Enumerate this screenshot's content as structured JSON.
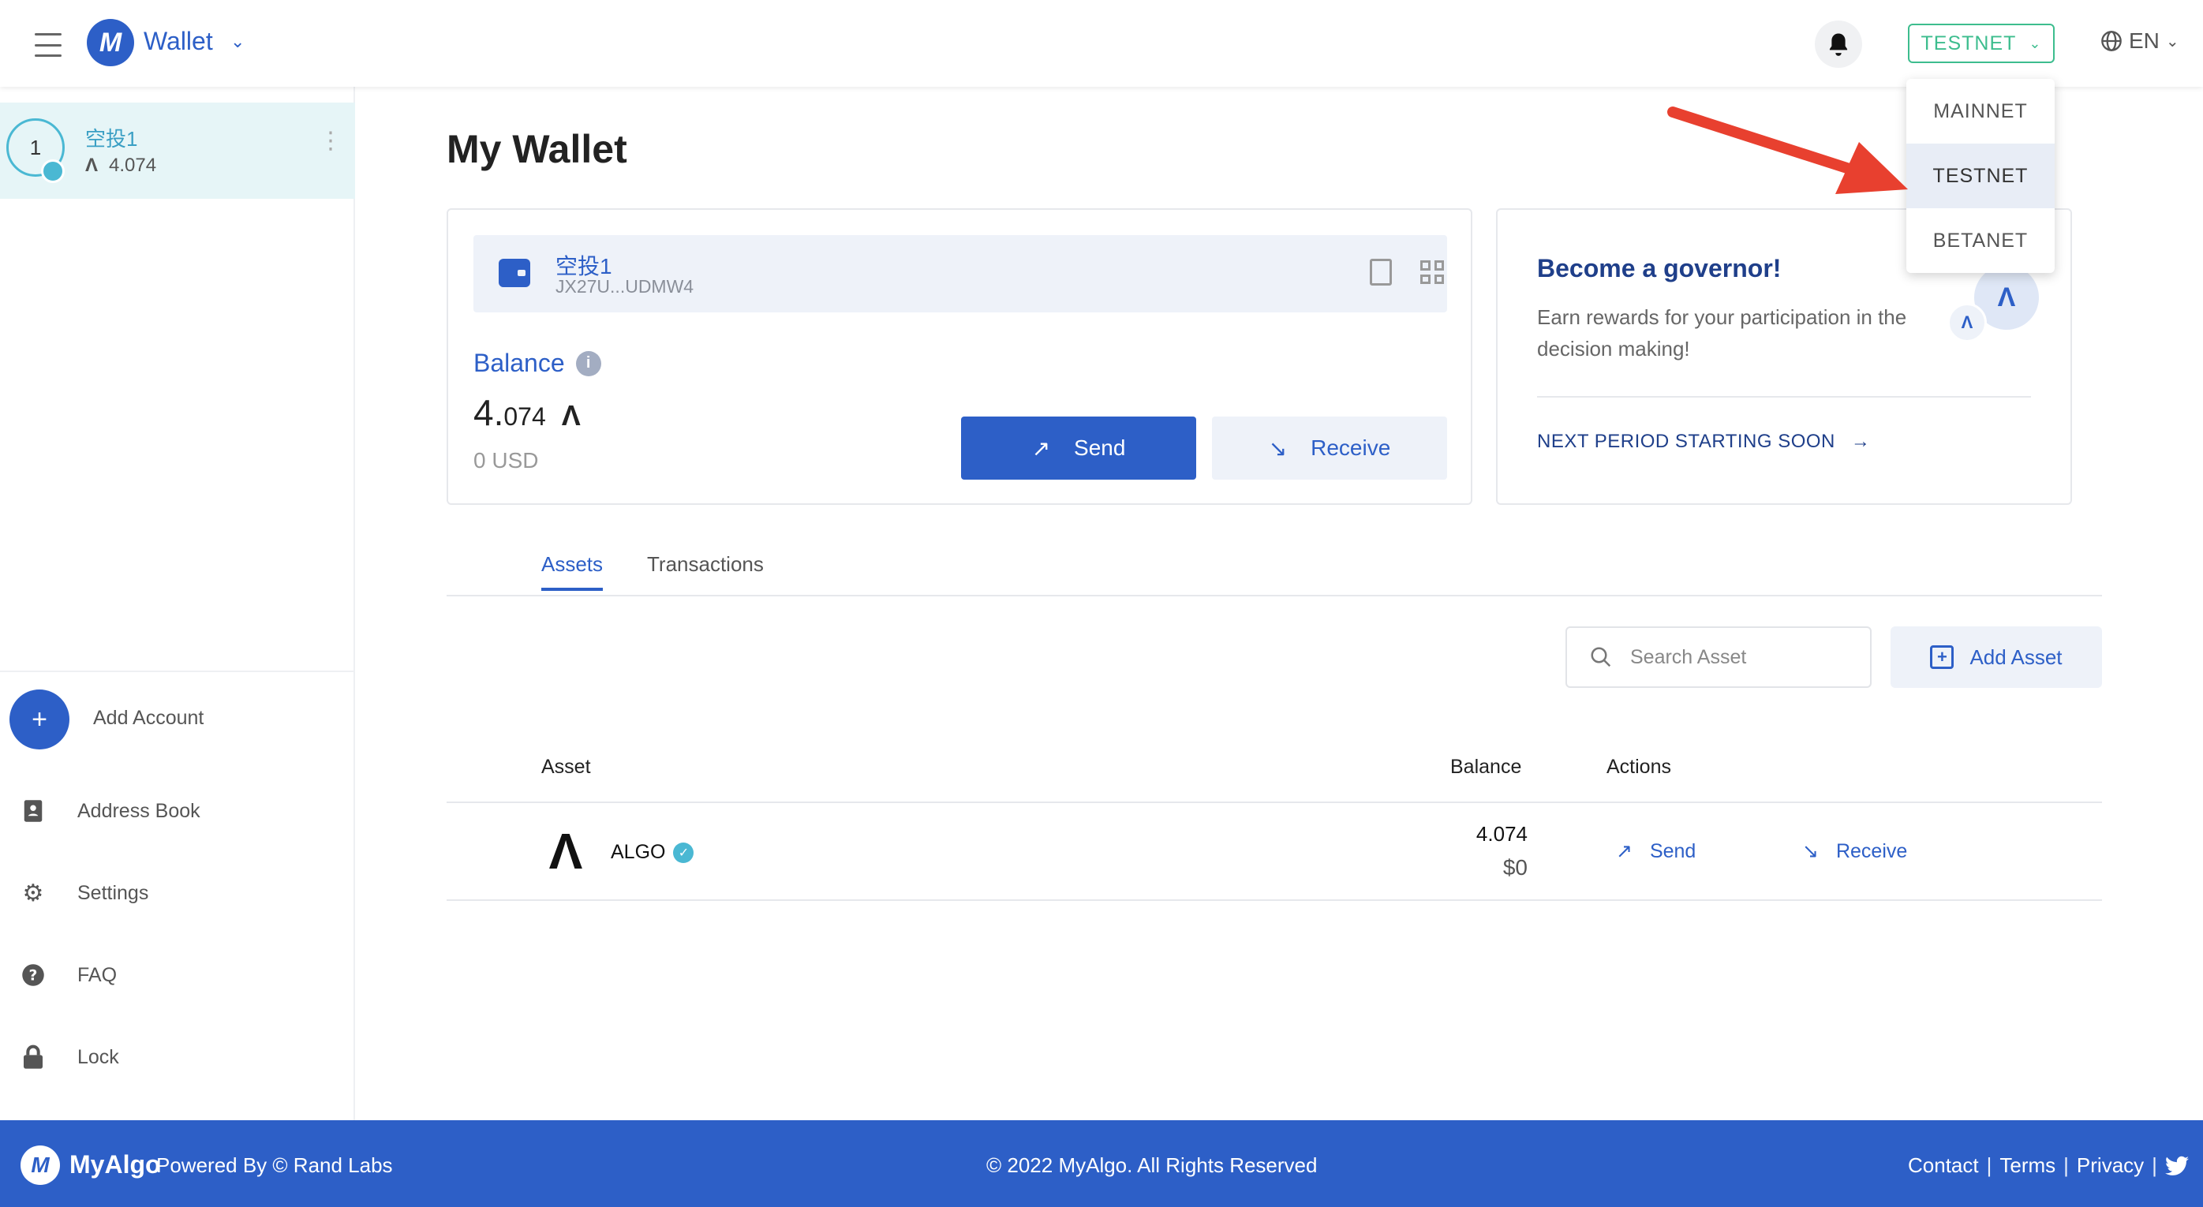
{
  "header": {
    "app_title": "Wallet",
    "network_selected": "TESTNET",
    "language": "EN"
  },
  "network_dropdown": {
    "options": [
      "MAINNET",
      "TESTNET",
      "BETANET"
    ],
    "active": "TESTNET"
  },
  "sidebar": {
    "account": {
      "index": "1",
      "name": "空投1",
      "balance": "4.074"
    },
    "add_account": "Add Account",
    "items": [
      {
        "label": "Address Book",
        "icon": "address-book-icon"
      },
      {
        "label": "Settings",
        "icon": "gear-icon"
      },
      {
        "label": "FAQ",
        "icon": "question-icon"
      },
      {
        "label": "Lock",
        "icon": "lock-icon"
      }
    ]
  },
  "main": {
    "title": "My Wallet",
    "wallet": {
      "name": "空投1",
      "address_short": "JX27U...UDMW4",
      "balance_label": "Balance",
      "balance_int": "4.",
      "balance_dec": "074",
      "balance_usd": "0 USD",
      "send_label": "Send",
      "receive_label": "Receive"
    },
    "governor": {
      "title": "Become a governor!",
      "text": "Earn rewards for your participation in the decision making!",
      "link": "NEXT PERIOD STARTING SOON"
    },
    "tabs": [
      {
        "label": "Assets",
        "active": true
      },
      {
        "label": "Transactions",
        "active": false
      }
    ],
    "search_placeholder": "Search Asset",
    "add_asset_label": "Add Asset",
    "table": {
      "headers": {
        "asset": "Asset",
        "balance": "Balance",
        "actions": "Actions"
      },
      "rows": [
        {
          "asset": "ALGO",
          "balance": "4.074",
          "usd": "$0",
          "send": "Send",
          "receive": "Receive"
        }
      ]
    }
  },
  "footer": {
    "brand": "MyAlgo",
    "powered": "Powered By  © Rand Labs",
    "copyright": "© 2022 MyAlgo. All Rights Reserved",
    "links": [
      "Contact",
      "Terms",
      "Privacy"
    ]
  },
  "colors": {
    "primary": "#2d5fc7",
    "testnet_green": "#3dbd8e",
    "accent_teal": "#4ab8d3",
    "annotation_red": "#e8402f"
  }
}
